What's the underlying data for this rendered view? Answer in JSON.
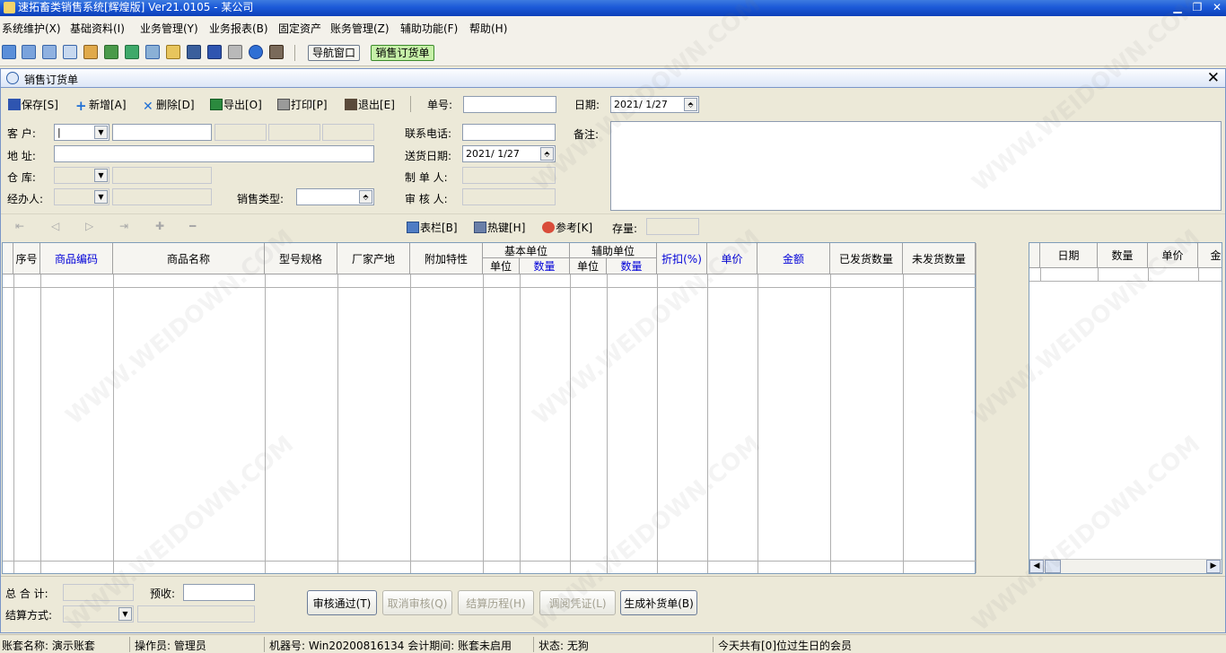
{
  "app": {
    "title": "速拓畜类销售系统[辉煌版] Ver21.0105  - 某公司",
    "min": "▁",
    "restore": "❐",
    "close": "✕"
  },
  "menu": [
    "系统维护(X)",
    "基础资料(I)",
    "业务管理(Y)",
    "业务报表(B)",
    "固定资产",
    "账务管理(Z)",
    "辅助功能(F)",
    "帮助(H)"
  ],
  "toolbar_tabs": {
    "nav": "导航窗口",
    "order": "销售订货单"
  },
  "child": {
    "title": "销售订货单",
    "close": "✕"
  },
  "actions": {
    "save": "保存[S]",
    "add": "新增[A]",
    "delete": "删除[D]",
    "export": "导出[O]",
    "print": "打印[P]",
    "exit": "退出[E]"
  },
  "form": {
    "order_no_label": "单号:",
    "order_no": "",
    "date_label": "日期:",
    "date": "2021/ 1/27",
    "customer_label": "客  户:",
    "customer": "|",
    "phone_label": "联系电话:",
    "phone": "",
    "remark_label": "备注:",
    "remark": "",
    "address_label": "地  址:",
    "address": "",
    "delivery_label": "送货日期:",
    "delivery": "2021/ 1/27",
    "warehouse_label": "仓  库:",
    "maker_label": "制 单 人:",
    "maker": "",
    "handler_label": "经办人:",
    "sales_type_label": "销售类型:",
    "auditor_label": "审 核 人:",
    "auditor": ""
  },
  "sub": {
    "cols": "表栏[B]",
    "hotkey": "热键[H]",
    "reference": "参考[K]",
    "stock_label": "存量:",
    "stock": ""
  },
  "grid": {
    "headers": [
      "序号",
      "商品编码",
      "商品名称",
      "型号规格",
      "厂家产地",
      "附加特性",
      "基本单位",
      "单位",
      "数量",
      "辅助单位",
      "单位",
      "数量",
      "折扣(%)",
      "单价",
      "金额",
      "已发货数量",
      "未发货数量"
    ]
  },
  "rgrid": {
    "headers": [
      "日期",
      "数量",
      "单价",
      "金"
    ]
  },
  "footer": {
    "total_label": "总 合 计:",
    "total": "",
    "prepaid_label": "预收:",
    "prepaid": "",
    "settle_label": "结算方式:",
    "btn_audit": "审核通过(T)",
    "btn_unaudit": "取消审核(Q)",
    "btn_history": "结算历程(H)",
    "btn_voucher": "调阅凭证(L)",
    "btn_replenish": "生成补货单(B)"
  },
  "status": {
    "book": "账套名称: 演示账套",
    "operator": "操作员: 管理员",
    "machine": "机器号: Win20200816134 会计期间: 账套未启用",
    "state": "状态: 无狗",
    "birthday": "今天共有[0]位过生日的会员"
  },
  "watermark": "WWW.WEIDOWN.COM"
}
